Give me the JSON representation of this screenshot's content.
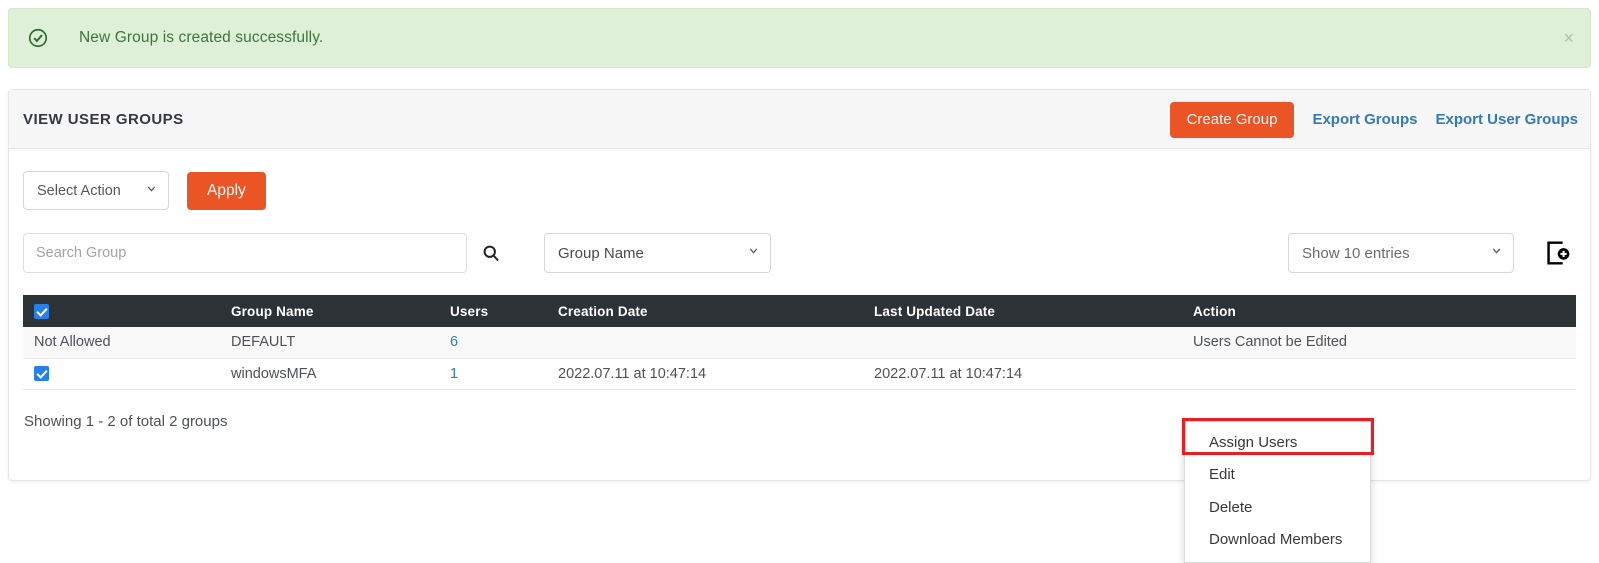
{
  "alert": {
    "message": "New Group is created successfully.",
    "icon": "check-circle-icon",
    "close_label": "×",
    "bg_color": "#dff0d8",
    "text_color": "#3c763d"
  },
  "card": {
    "title": "VIEW USER GROUPS",
    "header_actions": {
      "create_group": "Create Group",
      "export_groups": "Export Groups",
      "export_user_groups": "Export User Groups"
    }
  },
  "toolbar": {
    "select_action": {
      "value": "Select Action",
      "icon": "chevron-down-icon"
    },
    "apply_label": "Apply"
  },
  "filters": {
    "search_placeholder": "Search Group",
    "search_value": "",
    "search_icon": "search-icon",
    "group_name_select": "Group Name",
    "show_entries_select": "Show 10 entries",
    "add_icon": "add-document-icon"
  },
  "table": {
    "columns": [
      "",
      "Group Name",
      "Users",
      "Creation Date",
      "Last Updated Date",
      "Action"
    ],
    "header_checkbox_checked": true,
    "rows": [
      {
        "select_cell": "Not Allowed",
        "has_checkbox": false,
        "checked": false,
        "group_name": "DEFAULT",
        "users": "6",
        "creation_date": "",
        "last_updated_date": "",
        "action": "Users Cannot be Edited",
        "striped": true
      },
      {
        "select_cell": "",
        "has_checkbox": true,
        "checked": true,
        "group_name": "windowsMFA",
        "users": "1",
        "creation_date": "2022.07.11 at 10:47:14",
        "last_updated_date": "2022.07.11 at 10:47:14",
        "action": "",
        "striped": false
      }
    ],
    "footer": "Showing 1 - 2 of total 2 groups"
  },
  "action_menu": {
    "items": [
      "Assign Users",
      "Edit",
      "Delete",
      "Download Members"
    ],
    "highlighted_index": 0,
    "highlight_color": "#ee1c20"
  },
  "colors": {
    "accent": "#eb5424",
    "link": "#337ab7",
    "table_header_bg": "#2d3237",
    "checkbox": "#2680eb"
  }
}
